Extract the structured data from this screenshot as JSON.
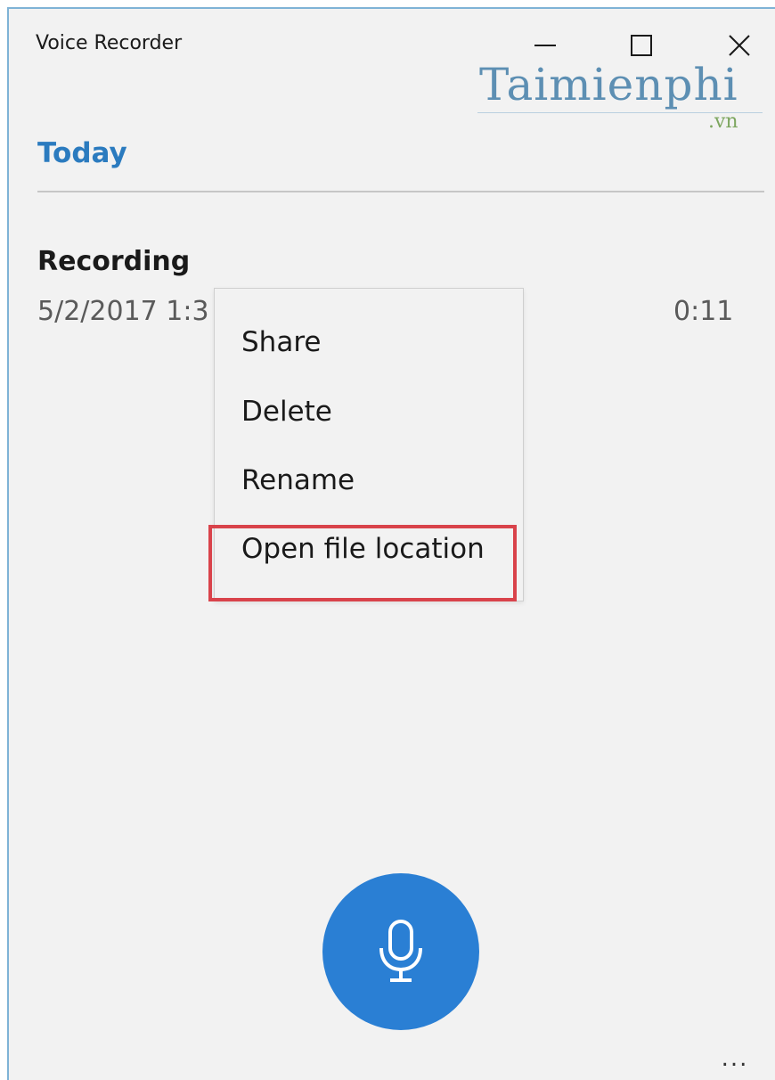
{
  "window": {
    "title": "Voice Recorder",
    "controls": {
      "minimize_icon": "minimize-icon",
      "maximize_icon": "maximize-icon",
      "close_icon": "close-icon"
    }
  },
  "watermark": {
    "text": "Taimienphi",
    "suffix": ".vn"
  },
  "section": {
    "header": "Today"
  },
  "recordings": [
    {
      "title": "Recording",
      "date": "5/2/2017 1:3",
      "duration": "0:11"
    }
  ],
  "context_menu": {
    "items": [
      {
        "label": "Share"
      },
      {
        "label": "Delete"
      },
      {
        "label": "Rename"
      },
      {
        "label": "Open file location"
      }
    ],
    "highlighted_item": "Open file location"
  },
  "bottom_bar": {
    "record_icon": "microphone-icon",
    "more_label": "..."
  },
  "colors": {
    "accent": "#2a7fd4",
    "header_text": "#2b7bbf",
    "highlight_border": "#d9434b",
    "background": "#f2f2f2"
  }
}
